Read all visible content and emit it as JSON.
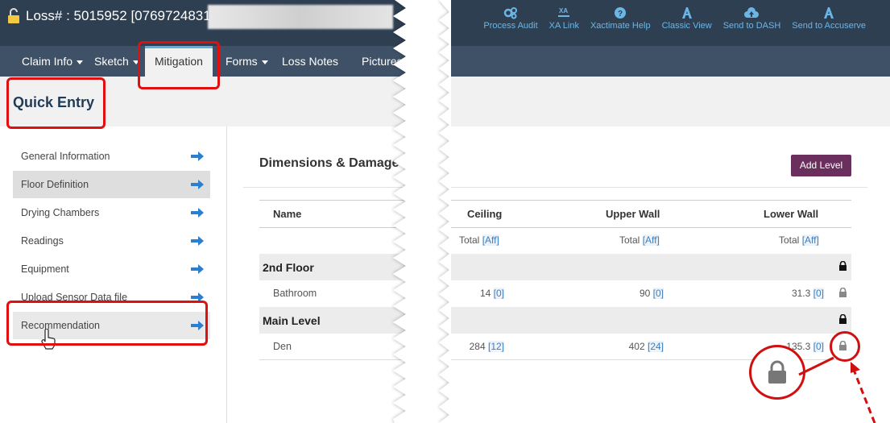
{
  "header": {
    "title": "Loss# : 5015952 [0769724831]",
    "links": [
      {
        "label": "Process Audit",
        "icon": "gears-icon"
      },
      {
        "label": "XA Link",
        "icon": "xa-link-icon"
      },
      {
        "label": "Xactimate Help",
        "icon": "help-icon"
      },
      {
        "label": "Classic View",
        "icon": "classic-view-icon"
      },
      {
        "label": "Send to DASH",
        "icon": "cloud-upload-icon"
      },
      {
        "label": "Send to Accuserve",
        "icon": "accuserve-icon"
      }
    ]
  },
  "nav": {
    "items": [
      {
        "label": "Claim Info",
        "dropdown": true
      },
      {
        "label": "Sketch",
        "dropdown": true
      },
      {
        "label": "Mitigation",
        "active": true
      },
      {
        "label": "Forms",
        "dropdown": true
      },
      {
        "label": "Loss Notes"
      },
      {
        "label": "Pictures"
      }
    ]
  },
  "quick_entry": {
    "title": "Quick Entry"
  },
  "sidebar": {
    "items": [
      {
        "label": "General Information"
      },
      {
        "label": "Floor Definition",
        "active": true
      },
      {
        "label": "Drying Chambers"
      },
      {
        "label": "Readings"
      },
      {
        "label": "Equipment"
      },
      {
        "label": "Upload Sensor Data file"
      },
      {
        "label": "Recommendation",
        "hovered": true
      }
    ]
  },
  "main": {
    "section_title": "Dimensions & Damage",
    "add_level_label": "Add Level",
    "columns": {
      "name": "Name",
      "ceiling": "Ceiling",
      "upper_wall": "Upper Wall",
      "lower_wall": "Lower Wall",
      "total_label": "Total",
      "aff_label": "[Aff]"
    },
    "levels": [
      {
        "name": "2nd Floor",
        "rooms": [
          {
            "name": "Bathroom",
            "ceiling": "14",
            "ceiling_b": "[0]",
            "upper": "90",
            "upper_b": "[0]",
            "lower": "31.3",
            "lower_b": "[0]"
          }
        ]
      },
      {
        "name": "Main Level",
        "rooms": [
          {
            "name": "Den",
            "ceiling": "284",
            "ceiling_b": "[12]",
            "upper": "402",
            "upper_b": "[24]",
            "lower": "135.3",
            "lower_b": "[0]"
          }
        ]
      }
    ]
  },
  "colors": {
    "header_bg": "#2f3f52",
    "nav_bg": "#3e5167",
    "link": "#6cb6e6",
    "add_level_bg": "#6b2f5d",
    "annotation": "#e01010"
  }
}
